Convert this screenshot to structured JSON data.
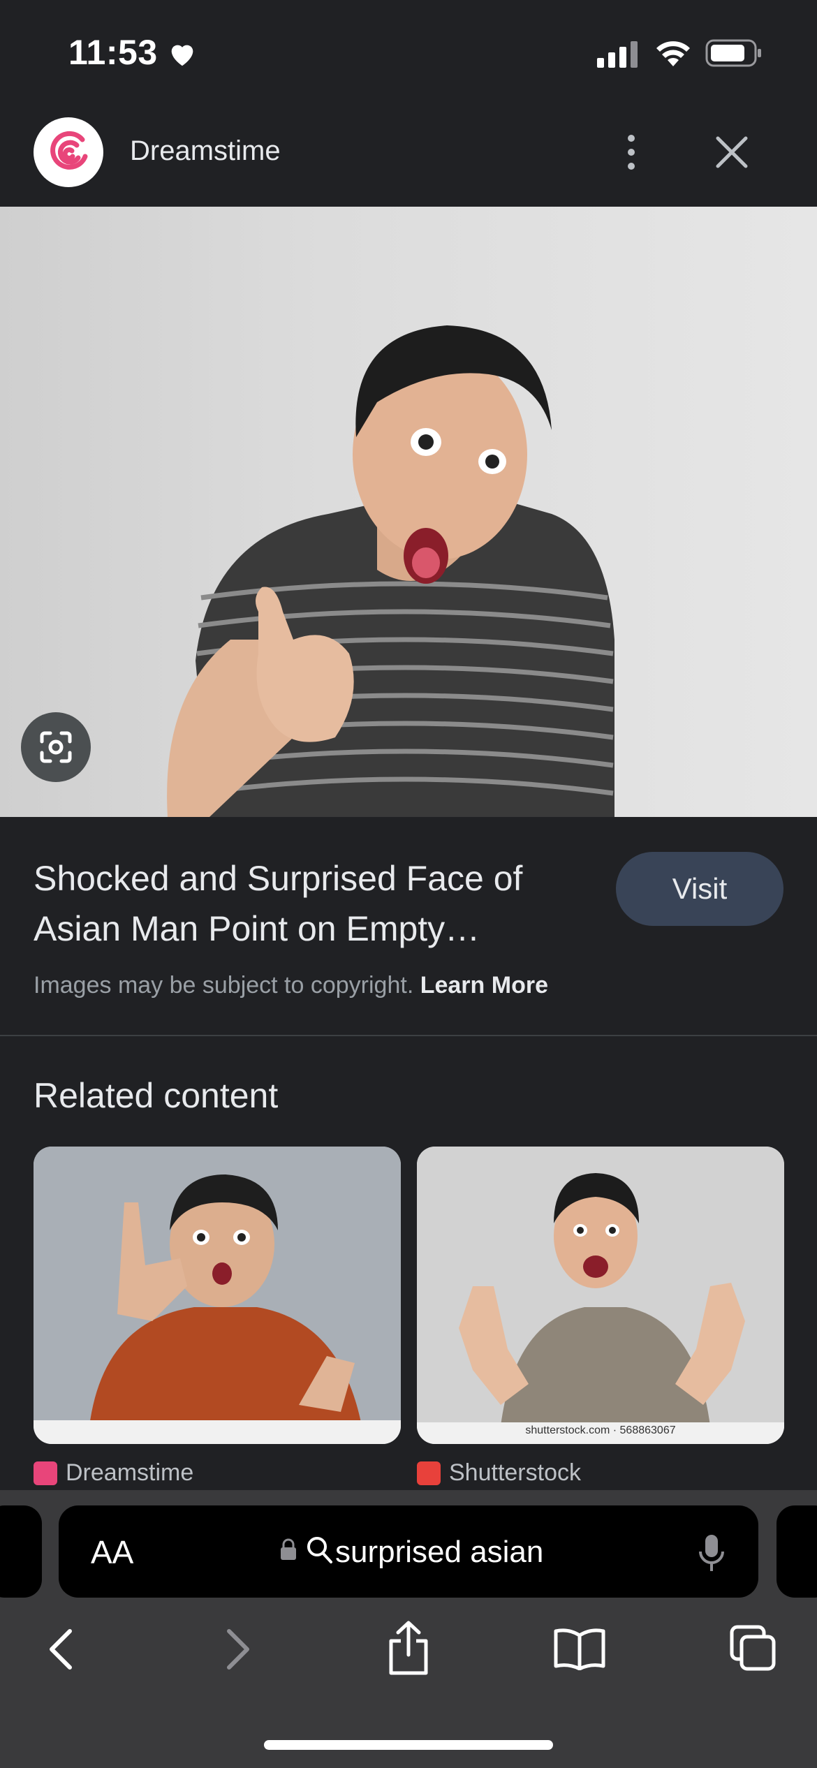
{
  "status_bar": {
    "time": "11:53"
  },
  "header": {
    "site_name": "Dreamstime"
  },
  "result": {
    "title_line1": "Shocked and Surprised Face of",
    "title_line2": "Asian Man Point on Empty…",
    "visit_label": "Visit",
    "copyright_text": "Images may be subject to copyright.",
    "learn_more": "Learn More"
  },
  "related": {
    "heading": "Related content",
    "items": [
      {
        "source": "Dreamstime",
        "shirt_color": "#b24a22"
      },
      {
        "source": "Shutterstock",
        "watermark": "shutterstock.com · 568863067",
        "shirt_color": "#8f8679"
      }
    ]
  },
  "browser": {
    "aa_label": "AA",
    "url_text": "surprised asian"
  },
  "colors": {
    "background": "#202124",
    "visit_button": "#394457",
    "dreamstime_brand": "#e8457a",
    "shutterstock_brand": "#e8413b"
  }
}
